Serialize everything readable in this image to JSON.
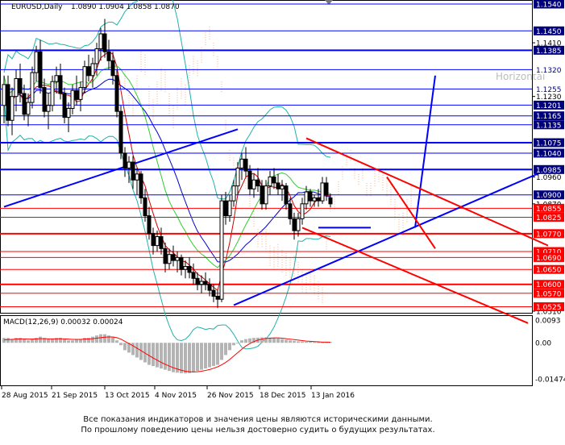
{
  "header": {
    "symbol": "EURUSD,Daily",
    "ohlc": "1.0890 1.0904 1.0858 1.0870"
  },
  "macd": {
    "label": "MACD(12,26,9) 0.00032 0.00024"
  },
  "disclaimer": {
    "line1": "Все показания индикаторов и значения цены являются историческими данными.",
    "line2": "По прошлому поведению цены нельзя достоверно судить о будущих результатах."
  },
  "colors": {
    "support_resistance_red": "#ff0000",
    "resistance_blue": "#0000ff",
    "highlight_label_bg": "#00007f",
    "red_label_bg": "#ff0000",
    "candles": "#000000",
    "macd_hist": "#b4b4b4",
    "macd_signal": "#ff0000",
    "ichimoku_cloud": "#f4b183"
  },
  "chart_data": [
    {
      "type": "candlestick",
      "title": "EURUSD,Daily",
      "x_ticks": [
        "28 Aug 2015",
        "21 Sep 2015",
        "13 Oct 2015",
        "4 Nov 2015",
        "26 Nov 2015",
        "18 Dec 2015",
        "13 Jan 2016"
      ],
      "y_ticks": [
        "1.1410",
        "1.1230",
        "1.0960",
        "1.0870",
        "1.0510"
      ],
      "ylim": [
        1.051,
        1.154
      ],
      "level_labels_blue": [
        "1.1540",
        "1.1450",
        "1.1385",
        "1.1320",
        "1.1255",
        "1.1201",
        "1.1165",
        "1.1135",
        "1.1075",
        "1.1040",
        "1.0985",
        "1.0900"
      ],
      "level_labels_red": [
        "1.0855",
        "1.0825",
        "1.0770",
        "1.0710",
        "1.0690",
        "1.0650",
        "1.0600",
        "1.0570",
        "1.0525"
      ],
      "level_values_blue": [
        1.154,
        1.145,
        1.1385,
        1.132,
        1.1255,
        1.1201,
        1.1165,
        1.1135,
        1.1075,
        1.104,
        1.0985,
        1.09
      ],
      "level_values_red": [
        1.0855,
        1.0825,
        1.077,
        1.071,
        1.069,
        1.065,
        1.06,
        1.057,
        1.0525
      ],
      "bold_levels": [
        1.1385,
        1.1075,
        1.0985,
        1.077,
        1.06
      ],
      "highlight_labels": [
        "1.1320",
        "1.1255"
      ],
      "trend_channels": [
        {
          "color": "blue",
          "lines": [
            [
              0,
              1.086,
              58,
              1.112
            ],
            [
              57,
              1.053,
              134,
              1.098
            ],
            [
              78,
              1.079,
              91,
              1.079
            ]
          ]
        },
        {
          "color": "blue-arrow",
          "points": [
            [
              102,
              1.079,
              107,
              1.13
            ]
          ]
        },
        {
          "color": "red",
          "lines": [
            [
              75,
              1.109,
              135,
              1.073
            ],
            [
              74,
              1.079,
              130,
              1.047
            ],
            [
              95,
              1.096,
              107,
              1.072
            ]
          ]
        }
      ],
      "overlay_text": "Horizontal",
      "candles_ohlc": [
        [
          1.12,
          1.13,
          1.114,
          1.127
        ],
        [
          1.127,
          1.13,
          1.113,
          1.115
        ],
        [
          1.115,
          1.126,
          1.11,
          1.123
        ],
        [
          1.123,
          1.132,
          1.118,
          1.129
        ],
        [
          1.129,
          1.134,
          1.121,
          1.124
        ],
        [
          1.124,
          1.127,
          1.115,
          1.117
        ],
        [
          1.117,
          1.124,
          1.113,
          1.121
        ],
        [
          1.121,
          1.133,
          1.119,
          1.131
        ],
        [
          1.131,
          1.14,
          1.128,
          1.138
        ],
        [
          1.138,
          1.142,
          1.124,
          1.126
        ],
        [
          1.126,
          1.129,
          1.116,
          1.118
        ],
        [
          1.118,
          1.124,
          1.112,
          1.12
        ],
        [
          1.12,
          1.13,
          1.118,
          1.128
        ],
        [
          1.128,
          1.133,
          1.124,
          1.13
        ],
        [
          1.13,
          1.134,
          1.122,
          1.124
        ],
        [
          1.124,
          1.126,
          1.114,
          1.116
        ],
        [
          1.116,
          1.121,
          1.111,
          1.119
        ],
        [
          1.119,
          1.127,
          1.117,
          1.125
        ],
        [
          1.125,
          1.13,
          1.12,
          1.122
        ],
        [
          1.122,
          1.128,
          1.118,
          1.126
        ],
        [
          1.126,
          1.135,
          1.124,
          1.133
        ],
        [
          1.133,
          1.137,
          1.128,
          1.13
        ],
        [
          1.13,
          1.136,
          1.126,
          1.134
        ],
        [
          1.134,
          1.141,
          1.13,
          1.139
        ],
        [
          1.139,
          1.146,
          1.135,
          1.144
        ],
        [
          1.144,
          1.149,
          1.136,
          1.138
        ],
        [
          1.138,
          1.142,
          1.132,
          1.135
        ],
        [
          1.135,
          1.138,
          1.127,
          1.13
        ],
        [
          1.13,
          1.132,
          1.116,
          1.118
        ],
        [
          1.118,
          1.12,
          1.102,
          1.104
        ],
        [
          1.104,
          1.106,
          1.096,
          1.099
        ],
        [
          1.099,
          1.103,
          1.094,
          1.101
        ],
        [
          1.101,
          1.103,
          1.092,
          1.095
        ],
        [
          1.095,
          1.099,
          1.09,
          1.097
        ],
        [
          1.097,
          1.098,
          1.087,
          1.089
        ],
        [
          1.089,
          1.092,
          1.081,
          1.083
        ],
        [
          1.083,
          1.086,
          1.075,
          1.077
        ],
        [
          1.077,
          1.079,
          1.07,
          1.073
        ],
        [
          1.073,
          1.078,
          1.071,
          1.076
        ],
        [
          1.076,
          1.079,
          1.07,
          1.072
        ],
        [
          1.072,
          1.074,
          1.064,
          1.067
        ],
        [
          1.067,
          1.072,
          1.065,
          1.07
        ],
        [
          1.07,
          1.073,
          1.066,
          1.068
        ],
        [
          1.068,
          1.071,
          1.064,
          1.069
        ],
        [
          1.069,
          1.07,
          1.063,
          1.065
        ],
        [
          1.065,
          1.068,
          1.062,
          1.066
        ],
        [
          1.066,
          1.069,
          1.062,
          1.064
        ],
        [
          1.064,
          1.067,
          1.06,
          1.062
        ],
        [
          1.062,
          1.064,
          1.058,
          1.06
        ],
        [
          1.06,
          1.063,
          1.057,
          1.061
        ],
        [
          1.061,
          1.064,
          1.058,
          1.06
        ],
        [
          1.06,
          1.062,
          1.056,
          1.058
        ],
        [
          1.058,
          1.06,
          1.054,
          1.056
        ],
        [
          1.056,
          1.058,
          1.052,
          1.055
        ],
        [
          1.055,
          1.09,
          1.054,
          1.088
        ],
        [
          1.088,
          1.091,
          1.08,
          1.083
        ],
        [
          1.083,
          1.09,
          1.081,
          1.088
        ],
        [
          1.088,
          1.095,
          1.086,
          1.093
        ],
        [
          1.093,
          1.101,
          1.09,
          1.099
        ],
        [
          1.099,
          1.104,
          1.095,
          1.102
        ],
        [
          1.102,
          1.106,
          1.096,
          1.098
        ],
        [
          1.098,
          1.1,
          1.09,
          1.092
        ],
        [
          1.092,
          1.097,
          1.089,
          1.095
        ],
        [
          1.095,
          1.099,
          1.091,
          1.093
        ],
        [
          1.093,
          1.095,
          1.085,
          1.087
        ],
        [
          1.087,
          1.095,
          1.085,
          1.093
        ],
        [
          1.093,
          1.098,
          1.09,
          1.096
        ],
        [
          1.096,
          1.099,
          1.092,
          1.094
        ],
        [
          1.094,
          1.097,
          1.09,
          1.092
        ],
        [
          1.092,
          1.095,
          1.088,
          1.093
        ],
        [
          1.093,
          1.094,
          1.085,
          1.087
        ],
        [
          1.087,
          1.089,
          1.08,
          1.082
        ],
        [
          1.082,
          1.084,
          1.075,
          1.078
        ],
        [
          1.078,
          1.084,
          1.076,
          1.082
        ],
        [
          1.082,
          1.089,
          1.08,
          1.087
        ],
        [
          1.087,
          1.093,
          1.085,
          1.091
        ],
        [
          1.091,
          1.092,
          1.086,
          1.088
        ],
        [
          1.088,
          1.09,
          1.086,
          1.089
        ],
        [
          1.089,
          1.092,
          1.086,
          1.088
        ],
        [
          1.088,
          1.096,
          1.087,
          1.094
        ],
        [
          1.094,
          1.096,
          1.088,
          1.09
        ],
        [
          1.089,
          1.0904,
          1.0858,
          1.087
        ]
      ]
    },
    {
      "type": "bar",
      "title": "MACD(12,26,9) 0.00032 0.00024",
      "y_ticks": [
        "0.0093",
        "0.00",
        "-0.01474"
      ],
      "ylim": [
        -0.01474,
        0.0093
      ],
      "histogram": [
        0.002,
        0.002,
        0.0015,
        0.002,
        0.002,
        0.0015,
        0.001,
        0.0015,
        0.002,
        0.0025,
        0.002,
        0.0015,
        0.0015,
        0.002,
        0.002,
        0.0015,
        0.001,
        0.001,
        0.0015,
        0.0015,
        0.002,
        0.002,
        0.0025,
        0.003,
        0.0035,
        0.0035,
        0.003,
        0.0025,
        0.001,
        -0.001,
        -0.003,
        -0.004,
        -0.005,
        -0.006,
        -0.007,
        -0.008,
        -0.009,
        -0.0095,
        -0.01,
        -0.0105,
        -0.011,
        -0.0115,
        -0.012,
        -0.0122,
        -0.0124,
        -0.0125,
        -0.0124,
        -0.012,
        -0.0115,
        -0.011,
        -0.0105,
        -0.01,
        -0.0095,
        -0.009,
        -0.007,
        -0.005,
        -0.003,
        -0.001,
        0.0,
        0.001,
        0.0015,
        0.0018,
        0.002,
        0.0021,
        0.0022,
        0.0022,
        0.0021,
        0.002,
        0.0018,
        0.0015,
        0.0012,
        0.001,
        0.0008,
        0.0006,
        0.0005,
        0.0004,
        0.0004,
        0.0003,
        0.0003,
        0.0003,
        0.0003,
        0.00032
      ],
      "signal": [
        0.0012,
        0.0013,
        0.0014,
        0.0015,
        0.0016,
        0.0016,
        0.0015,
        0.0015,
        0.0016,
        0.0017,
        0.0017,
        0.0016,
        0.0016,
        0.0016,
        0.0017,
        0.0016,
        0.0015,
        0.0014,
        0.0014,
        0.0014,
        0.0015,
        0.0016,
        0.0017,
        0.0019,
        0.0021,
        0.0023,
        0.0024,
        0.0024,
        0.0021,
        0.0015,
        0.0006,
        -0.0003,
        -0.0012,
        -0.0022,
        -0.0032,
        -0.0042,
        -0.0052,
        -0.0062,
        -0.0071,
        -0.008,
        -0.0088,
        -0.0095,
        -0.0102,
        -0.0107,
        -0.0112,
        -0.0116,
        -0.0118,
        -0.0119,
        -0.0118,
        -0.0116,
        -0.0113,
        -0.0109,
        -0.0104,
        -0.0098,
        -0.009,
        -0.008,
        -0.0068,
        -0.0054,
        -0.004,
        -0.0026,
        -0.0013,
        -0.0003,
        0.0005,
        0.0011,
        0.0015,
        0.0018,
        0.0019,
        0.002,
        0.002,
        0.0019,
        0.0017,
        0.0015,
        0.0013,
        0.0011,
        0.0009,
        0.0007,
        0.0006,
        0.0005,
        0.0004,
        0.0003,
        0.0003,
        0.00024
      ]
    }
  ]
}
